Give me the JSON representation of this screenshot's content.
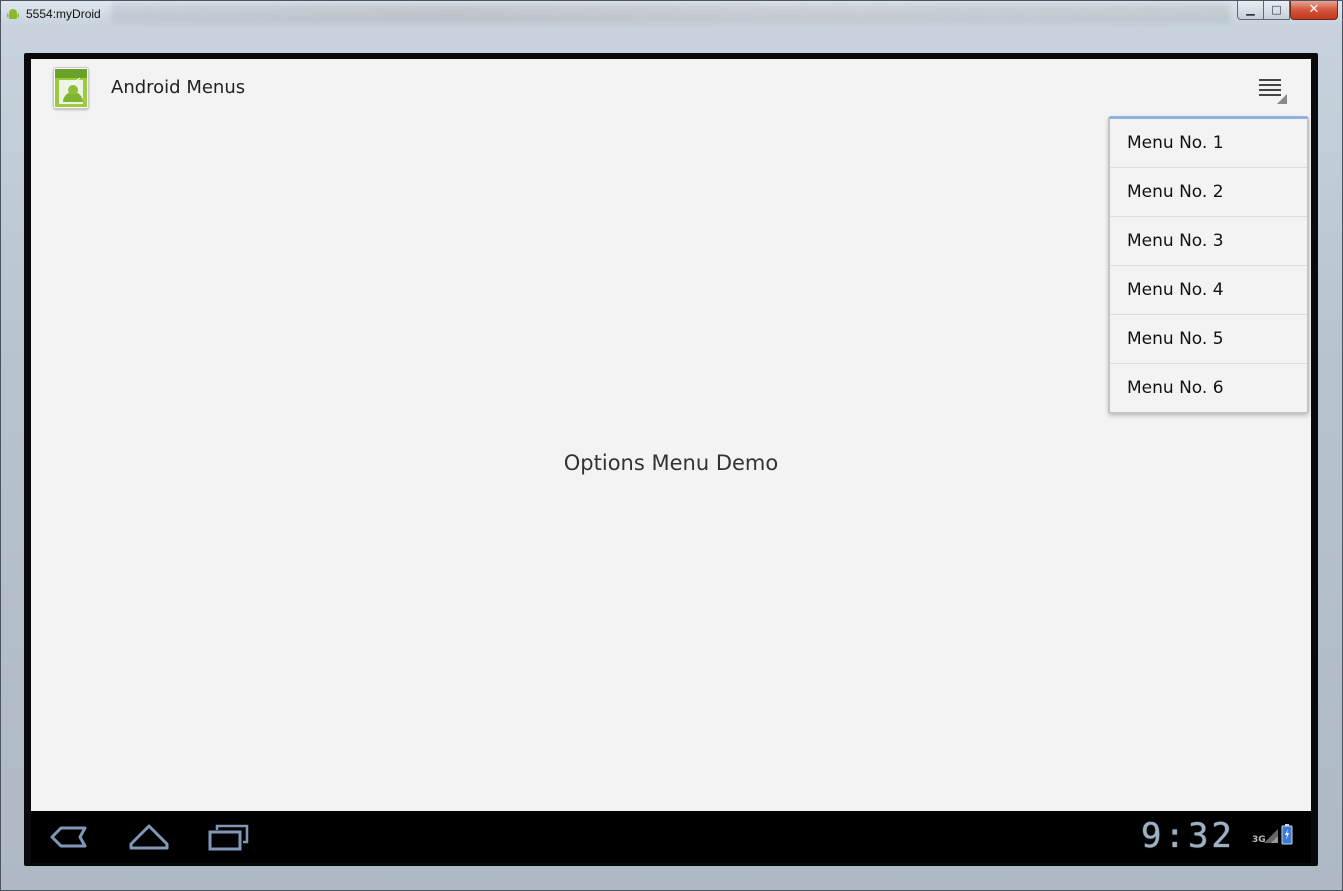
{
  "window": {
    "title": "5554:myDroid",
    "min_glyph": "▁",
    "max_glyph": "□",
    "close_glyph": "✕"
  },
  "actionbar": {
    "title": "Android Menus",
    "overflow_icon": "overflow-menu-icon"
  },
  "options_menu": {
    "items": [
      {
        "label": "Menu No. 1"
      },
      {
        "label": "Menu No. 2"
      },
      {
        "label": "Menu No. 3"
      },
      {
        "label": "Menu No. 4"
      },
      {
        "label": "Menu No. 5"
      },
      {
        "label": "Menu No. 6"
      }
    ]
  },
  "content": {
    "center_text": "Options Menu Demo"
  },
  "systembar": {
    "clock": "9:32",
    "network": "3G",
    "icons": [
      "back-icon",
      "home-icon",
      "recent-apps-icon",
      "signal-icon",
      "battery-icon"
    ]
  },
  "colors": {
    "screen_bg": "#f3f3f3",
    "menu_accent": "#8fb1e0",
    "systembar_bg": "#000000",
    "clock": "#9fb0c4"
  }
}
